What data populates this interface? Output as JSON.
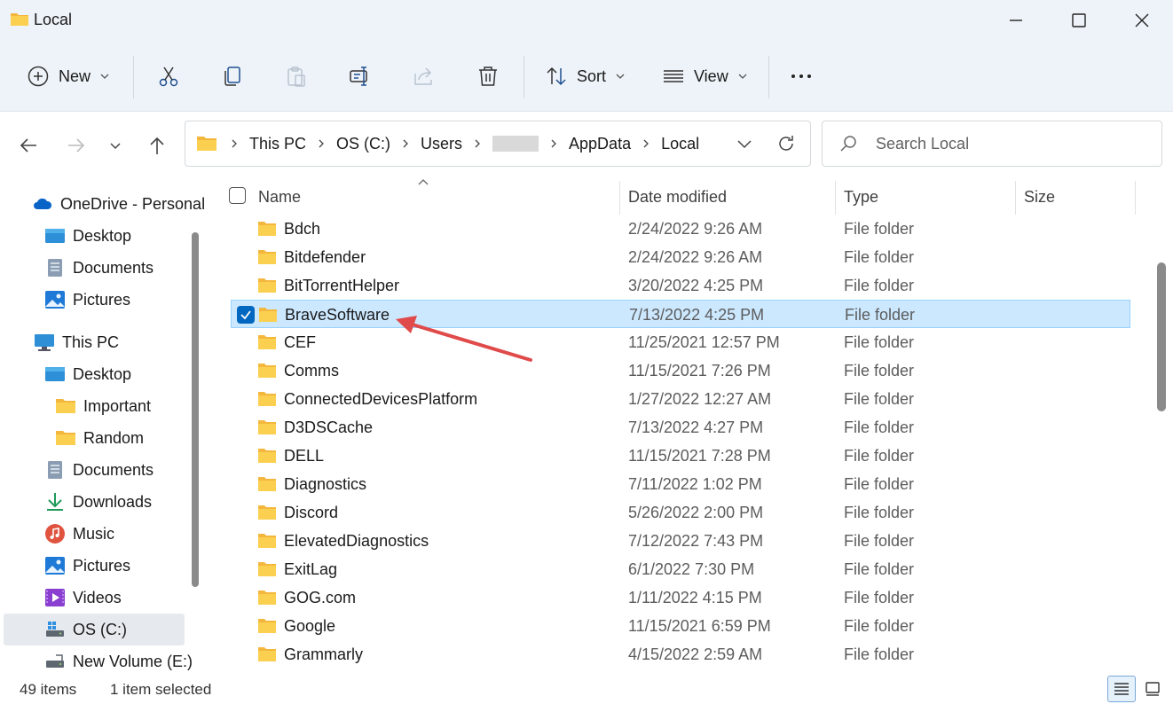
{
  "window": {
    "title": "Local",
    "minimize_icon": "minimize-icon",
    "maximize_icon": "maximize-icon",
    "close_icon": "close-icon"
  },
  "toolbar": {
    "new_label": "New",
    "sort_label": "Sort",
    "view_label": "View",
    "buttons": [
      "new-icon",
      "cut-icon",
      "copy-icon",
      "paste-icon",
      "rename-icon",
      "share-icon",
      "delete-icon",
      "sort-icon",
      "view-icon",
      "more-icon"
    ]
  },
  "address": {
    "crumbs": [
      "This PC",
      "OS (C:)",
      "Users",
      "",
      "AppData",
      "Local"
    ],
    "redacted_crumb_index": 3
  },
  "search": {
    "placeholder": "Search Local"
  },
  "sidebar": {
    "items": [
      {
        "label": "OneDrive - Personal",
        "icon": "onedrive-icon"
      },
      {
        "label": "Desktop",
        "icon": "desktop-icon"
      },
      {
        "label": "Documents",
        "icon": "documents-icon"
      },
      {
        "label": "Pictures",
        "icon": "pictures-icon"
      },
      {
        "label": "This PC",
        "icon": "this-pc-icon"
      },
      {
        "label": "Desktop",
        "icon": "desktop-icon"
      },
      {
        "label": "Important",
        "icon": "folder-icon"
      },
      {
        "label": "Random",
        "icon": "folder-icon"
      },
      {
        "label": "Documents",
        "icon": "documents-icon"
      },
      {
        "label": "Downloads",
        "icon": "downloads-icon"
      },
      {
        "label": "Music",
        "icon": "music-icon"
      },
      {
        "label": "Pictures",
        "icon": "pictures-icon"
      },
      {
        "label": "Videos",
        "icon": "videos-icon"
      },
      {
        "label": "OS (C:)",
        "icon": "drive-icon",
        "selected": true
      },
      {
        "label": "New Volume (E:)",
        "icon": "drive-icon"
      }
    ]
  },
  "columns": {
    "name": "Name",
    "date": "Date modified",
    "type": "Type",
    "size": "Size"
  },
  "files": [
    {
      "name": "Bdch",
      "date": "2/24/2022 9:26 AM",
      "type": "File folder"
    },
    {
      "name": "Bitdefender",
      "date": "2/24/2022 9:26 AM",
      "type": "File folder"
    },
    {
      "name": "BitTorrentHelper",
      "date": "3/20/2022 4:25 PM",
      "type": "File folder"
    },
    {
      "name": "BraveSoftware",
      "date": "7/13/2022 4:25 PM",
      "type": "File folder",
      "selected": true
    },
    {
      "name": "CEF",
      "date": "11/25/2021 12:57 PM",
      "type": "File folder"
    },
    {
      "name": "Comms",
      "date": "11/15/2021 7:26 PM",
      "type": "File folder"
    },
    {
      "name": "ConnectedDevicesPlatform",
      "date": "1/27/2022 12:27 AM",
      "type": "File folder"
    },
    {
      "name": "D3DSCache",
      "date": "7/13/2022 4:27 PM",
      "type": "File folder"
    },
    {
      "name": "DELL",
      "date": "11/15/2021 7:28 PM",
      "type": "File folder"
    },
    {
      "name": "Diagnostics",
      "date": "7/11/2022 1:02 PM",
      "type": "File folder"
    },
    {
      "name": "Discord",
      "date": "5/26/2022 2:00 PM",
      "type": "File folder"
    },
    {
      "name": "ElevatedDiagnostics",
      "date": "7/12/2022 7:43 PM",
      "type": "File folder"
    },
    {
      "name": "ExitLag",
      "date": "6/1/2022 7:30 PM",
      "type": "File folder"
    },
    {
      "name": "GOG.com",
      "date": "1/11/2022 4:15 PM",
      "type": "File folder"
    },
    {
      "name": "Google",
      "date": "11/15/2021 6:59 PM",
      "type": "File folder"
    },
    {
      "name": "Grammarly",
      "date": "4/15/2022 2:59 AM",
      "type": "File folder"
    }
  ],
  "status": {
    "item_count": "49 items",
    "selection": "1 item selected"
  },
  "colors": {
    "accent": "#0067c0",
    "selection_bg": "#cce8ff",
    "folder": "#f8c94a",
    "annotation_arrow": "#e04a4a"
  }
}
